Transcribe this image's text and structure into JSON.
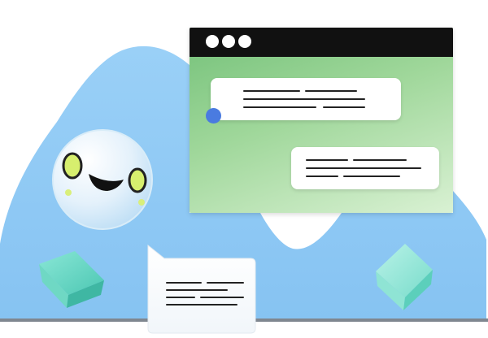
{
  "colors": {
    "blob": "#8ec8f4",
    "window_gradient_top": "#74c179",
    "window_gradient_bottom": "#d9f1d3",
    "titlebar": "#111111",
    "status_dot": "#4a7be0",
    "face_eye_ring": "#c9e45a",
    "cube": "#7de0cf"
  },
  "icons": {
    "window_controls": [
      "window-dot-icon",
      "window-dot-icon",
      "window-dot-icon"
    ],
    "mascot": "smiley-face-icon",
    "cubes": [
      "cube-icon",
      "cube-icon"
    ],
    "note": "document-note-icon"
  }
}
